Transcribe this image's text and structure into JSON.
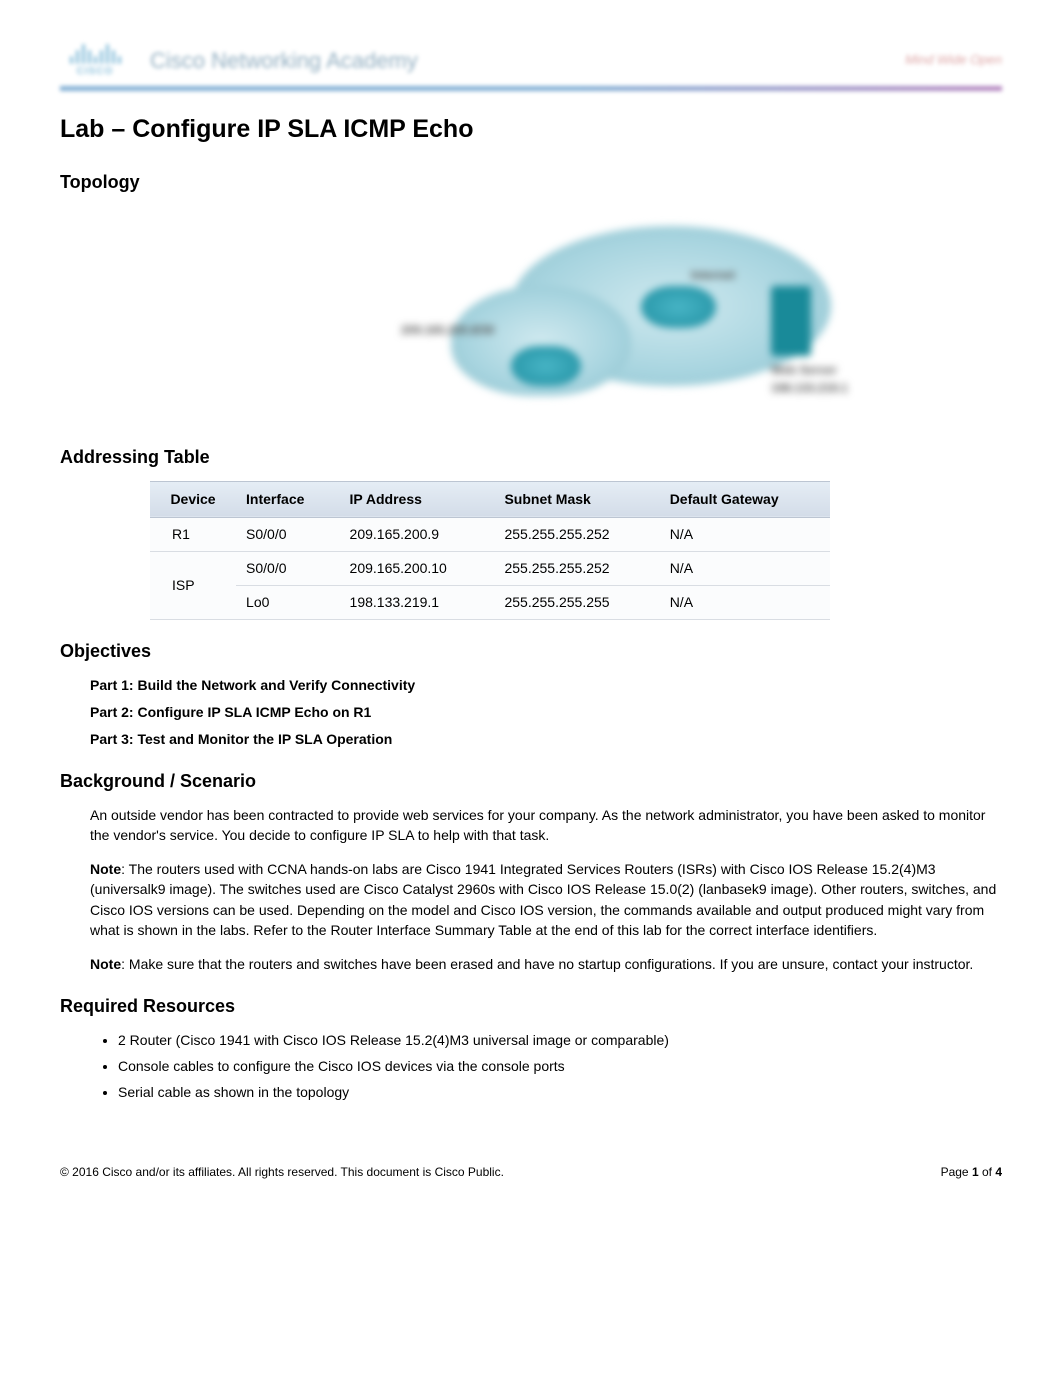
{
  "header": {
    "brand": "CISCO",
    "academy": "Cisco Networking Academy",
    "tagline": "Mind Wide Open"
  },
  "title": "Lab – Configure IP SLA ICMP Echo",
  "sections": {
    "topology": "Topology",
    "addressing": "Addressing Table",
    "objectives": "Objectives",
    "background": "Background / Scenario",
    "resources": "Required Resources"
  },
  "topology_labels": {
    "left": "209.165.200.8/30",
    "internet": "Internet",
    "server": "Web Server\n198.133.219.1"
  },
  "addr_table": {
    "headers": [
      "Device",
      "Interface",
      "IP Address",
      "Subnet Mask",
      "Default Gateway"
    ],
    "rows": [
      {
        "device": "R1",
        "iface": "S0/0/0",
        "ip": "209.165.200.9",
        "mask": "255.255.255.252",
        "gw": "N/A",
        "rowspan": 1
      },
      {
        "device": "ISP",
        "iface": "S0/0/0",
        "ip": "209.165.200.10",
        "mask": "255.255.255.252",
        "gw": "N/A",
        "rowspan": 2
      },
      {
        "device": "",
        "iface": "Lo0",
        "ip": "198.133.219.1",
        "mask": "255.255.255.255",
        "gw": "N/A",
        "rowspan": 0
      }
    ]
  },
  "objectives": [
    "Part 1: Build the Network and Verify Connectivity",
    "Part 2: Configure IP SLA ICMP Echo on R1",
    "Part 3: Test and Monitor the IP SLA Operation"
  ],
  "background": {
    "p1": "An outside vendor has been contracted to provide web services for your company. As the network administrator, you have been asked to monitor the vendor's service. You decide to configure IP SLA to help with that task.",
    "note1_label": "Note",
    "note1": ": The routers used with CCNA hands-on labs are Cisco 1941 Integrated Services Routers (ISRs) with Cisco IOS Release 15.2(4)M3 (universalk9 image). The switches used are Cisco Catalyst 2960s with Cisco IOS Release 15.0(2) (lanbasek9 image). Other routers, switches, and Cisco IOS versions can be used. Depending on the model and Cisco IOS version, the commands available and output produced might vary from what is shown in the labs. Refer to the Router Interface Summary Table at the end of this lab for the correct interface identifiers.",
    "note2_label": "Note",
    "note2": ": Make sure that the routers and switches have been erased and have no startup configurations. If you are unsure, contact your instructor."
  },
  "resources": [
    "2 Router (Cisco 1941 with Cisco IOS Release 15.2(4)M3 universal image or comparable)",
    "Console cables to configure the Cisco IOS devices via the console ports",
    "Serial cable as shown in the topology"
  ],
  "footer": {
    "copyright": "© 2016 Cisco and/or its affiliates. All rights reserved. This document is Cisco Public.",
    "page_label": "Page ",
    "page_current": "1",
    "page_of": " of ",
    "page_total": "4"
  }
}
